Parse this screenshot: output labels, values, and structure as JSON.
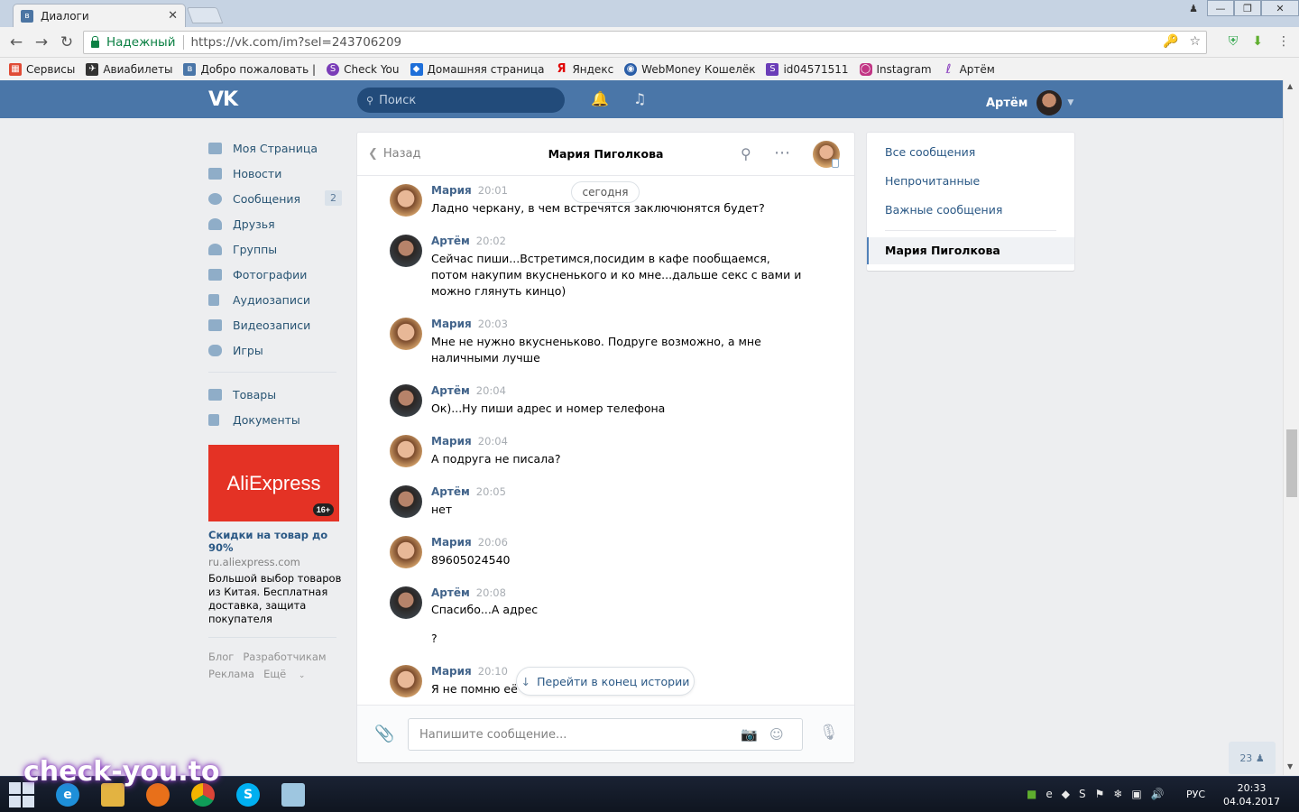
{
  "browser": {
    "tab_title": "Диалоги",
    "security_label": "Надежный",
    "url": "https://vk.com/im?sel=243706209",
    "bookmarks": [
      {
        "label": "Сервисы",
        "color": "#e04b36"
      },
      {
        "label": "Авиабилеты",
        "color": "#333333"
      },
      {
        "label": "Добро пожаловать |",
        "color": "#4a76a8"
      },
      {
        "label": "Check You",
        "color": "#7a3db8"
      },
      {
        "label": "Домашняя страница",
        "color": "#1e6fd9"
      },
      {
        "label": "Яндекс",
        "color": "#e00000"
      },
      {
        "label": "WebMoney Кошелёк",
        "color": "#2a5ea8"
      },
      {
        "label": "id04571511",
        "color": "#6a3db8"
      },
      {
        "label": "Instagram",
        "color": "#c13584"
      },
      {
        "label": "Артём",
        "color": "#8a3fbf"
      }
    ]
  },
  "header": {
    "search_placeholder": "Поиск",
    "user_name": "Артём"
  },
  "leftnav": {
    "items": [
      {
        "label": "Моя Страница",
        "icon": "home-icon"
      },
      {
        "label": "Новости",
        "icon": "news-icon"
      },
      {
        "label": "Сообщения",
        "icon": "messages-icon",
        "badge": "2"
      },
      {
        "label": "Друзья",
        "icon": "friends-icon"
      },
      {
        "label": "Группы",
        "icon": "groups-icon"
      },
      {
        "label": "Фотографии",
        "icon": "photos-icon"
      },
      {
        "label": "Аудиозаписи",
        "icon": "audio-icon"
      },
      {
        "label": "Видеозаписи",
        "icon": "video-icon"
      },
      {
        "label": "Игры",
        "icon": "games-icon"
      }
    ],
    "items2": [
      {
        "label": "Товары",
        "icon": "market-icon"
      },
      {
        "label": "Документы",
        "icon": "docs-icon"
      }
    ],
    "ad": {
      "banner_text": "AliExpress",
      "age": "16+",
      "title": "Скидки на товар до 90%",
      "domain": "ru.aliexpress.com",
      "description": "Большой выбор товаров из Китая. Бесплатная доставка, защита покупателя"
    },
    "footer": {
      "blog": "Блог",
      "dev": "Разработчикам",
      "ads": "Реклама",
      "more": "Ещё"
    }
  },
  "chat": {
    "back_label": "Назад",
    "title": "Мария Пиголкова",
    "date_divider": "сегодня",
    "jump_label": "Перейти в конец истории",
    "input_placeholder": "Напишите сообщение...",
    "messages": [
      {
        "author": "Мария",
        "time": "20:01",
        "text": "Ладно черкану, в чем встречятся заключюнятся будет?",
        "who": "maria"
      },
      {
        "author": "Артём",
        "time": "20:02",
        "text": "Сейчас пиши...Встретимся,посидим в кафе пообщаемся,\nпотом накупим вкусненького и ко мне...дальше секс с вами и\nможно глянуть кинцо)",
        "who": "artem"
      },
      {
        "author": "Мария",
        "time": "20:03",
        "text": "Мне не нужно вкусненьково. Подруге возможно, а мне\nналичными лучше",
        "who": "maria"
      },
      {
        "author": "Артём",
        "time": "20:04",
        "text": "Ок)...Ну пиши адрес и номер телефона",
        "who": "artem"
      },
      {
        "author": "Мария",
        "time": "20:04",
        "text": "А подруга не писала?",
        "who": "maria"
      },
      {
        "author": "Артём",
        "time": "20:05",
        "text": "нет",
        "who": "artem"
      },
      {
        "author": "Мария",
        "time": "20:06",
        "text": "89605024540",
        "who": "maria"
      },
      {
        "author": "Артём",
        "time": "20:08",
        "text": "Спасибо...А адрес\n\n?",
        "who": "artem"
      },
      {
        "author": "Мария",
        "time": "20:10",
        "text": "Я не помню её а",
        "who": "maria"
      }
    ]
  },
  "rightnav": {
    "all": "Все сообщения",
    "unread": "Непрочитанные",
    "important": "Важные сообщения",
    "active": "Мария Пиголкова"
  },
  "friends_float": {
    "count": "23"
  },
  "taskbar": {
    "lang": "РУС",
    "time": "20:33",
    "date": "04.04.2017"
  },
  "watermark": "check-you.to"
}
